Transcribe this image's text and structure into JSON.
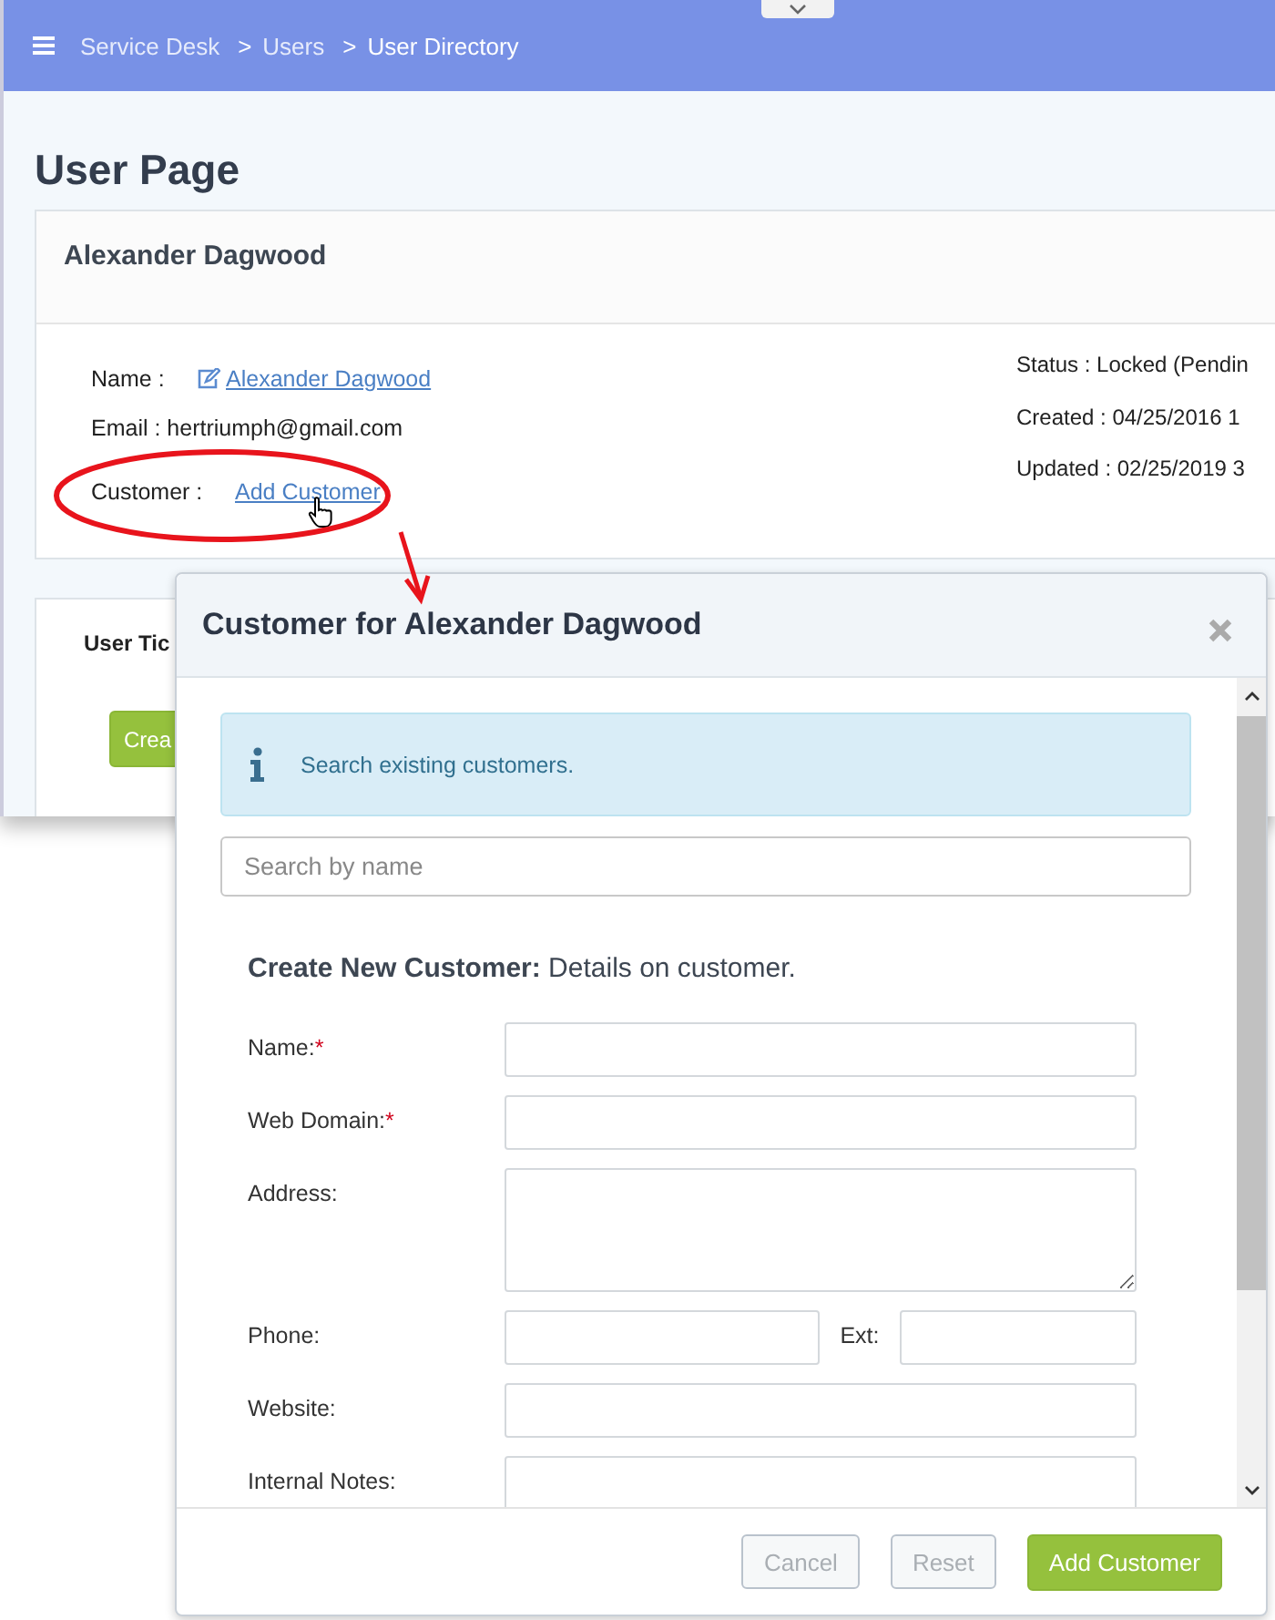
{
  "breadcrumb": [
    {
      "label": "Service Desk",
      "selected": false
    },
    {
      "separator": ">",
      "label": "Users",
      "selected": false
    },
    {
      "separator": ">",
      "label": "User Directory",
      "selected": true
    }
  ],
  "page_title": "User Page",
  "user_card": {
    "title": "Alexander Dagwood",
    "left": [
      {
        "label": "Name :",
        "value": "Alexander Dagwood",
        "kind": "edit-link"
      },
      {
        "label": "Email :",
        "value": "hertriumph@gmail.com",
        "kind": "text"
      },
      {
        "label": "Customer :",
        "value": "Add Customer",
        "kind": "link"
      }
    ],
    "right": [
      "Status : Locked (Pendin",
      "Created : 04/25/2016 1",
      "Updated : 02/25/2019 3"
    ]
  },
  "tickets_card": {
    "title": "User Tic",
    "button": "Crea"
  },
  "modal": {
    "title": "Customer for Alexander Dagwood",
    "info": "Search existing customers.",
    "search": {
      "placeholder": "Search by name"
    },
    "heading": "**Create New Customer:** Details on customer.",
    "fields": [
      {
        "label": "Name:",
        "required_mark": "*",
        "kind": "input"
      },
      {
        "label": "Web Domain:",
        "required_mark": "*",
        "kind": "input"
      },
      {
        "label": "Address:",
        "kind": "textarea"
      },
      {
        "label": "Phone:",
        "kind": "split",
        "second_label": "Ext:"
      },
      {
        "label": "Website:",
        "kind": "input"
      },
      {
        "label": "Internal Notes:",
        "kind": "input"
      }
    ],
    "buttons": [
      {
        "label": "Cancel",
        "disabled": true,
        "kind": "secondary"
      },
      {
        "label": "Reset",
        "disabled": true,
        "kind": "secondary"
      },
      {
        "label": "Add Customer",
        "disabled": false,
        "kind": "primary"
      }
    ]
  }
}
